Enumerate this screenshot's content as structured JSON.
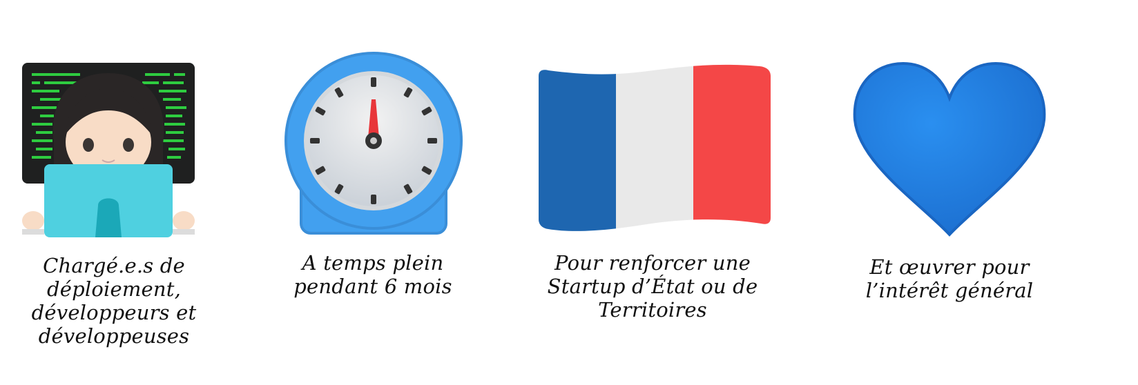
{
  "cards": [
    {
      "icon": "developer-at-laptop-icon",
      "caption_lines": [
        "Chargé.e.s de",
        "déploiement,",
        "développeurs et",
        "développeuses"
      ]
    },
    {
      "icon": "stopwatch-icon",
      "caption_lines": [
        "A temps plein",
        "pendant 6 mois"
      ]
    },
    {
      "icon": "france-flag-icon",
      "caption_lines": [
        "Pour renforcer une",
        "Startup d’État ou de",
        "Territoires"
      ]
    },
    {
      "icon": "blue-heart-icon",
      "caption_lines": [
        "Et œuvrer pour",
        "l’intérêt général"
      ]
    }
  ],
  "colors": {
    "screen_bg": "#1f2020",
    "code_green": "#2ecc40",
    "laptop": "#4fd0e0",
    "stopwatch_blue": "#42a0ef",
    "flag_blue": "#1e66b0",
    "flag_white": "#e9e9e9",
    "flag_red": "#f44747",
    "heart_blue": "#1f7fe0"
  }
}
